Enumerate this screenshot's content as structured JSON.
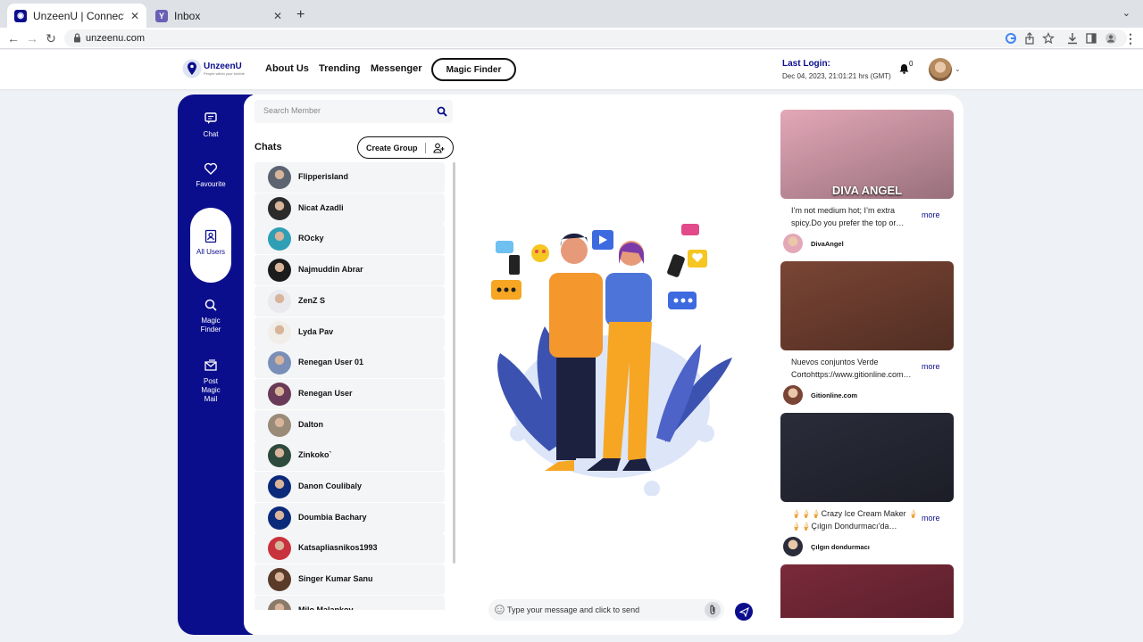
{
  "browser": {
    "tabs": [
      {
        "title": "UnzeenU | Connect your bubbl",
        "active": true
      },
      {
        "title": "Inbox",
        "active": false
      }
    ],
    "new_tab": "+",
    "url": "unzeenu.com"
  },
  "site": {
    "brand": "UnzeenU",
    "tagline": "People within your bubble",
    "nav": [
      "About Us",
      "Trending",
      "Messenger"
    ],
    "magic_finder": "Magic Finder",
    "last_login_label": "Last Login:",
    "last_login_value": "Dec 04, 2023, 21:01:21 hrs (GMT)",
    "notif_count": "0"
  },
  "sidebar": {
    "items": [
      {
        "label": "Chat",
        "icon": "chat-icon"
      },
      {
        "label": "Favourite",
        "icon": "heart-icon"
      },
      {
        "label": "All Users",
        "icon": "users-icon",
        "active": true
      },
      {
        "label": "Magic Finder",
        "icon": "search-icon"
      },
      {
        "label": "Post Magic Mail",
        "icon": "mail-icon"
      }
    ]
  },
  "chats": {
    "search_placeholder": "Search Member",
    "title": "Chats",
    "create_group": "Create Group",
    "list": [
      {
        "name": "Flipperisland",
        "color": "#5b6470"
      },
      {
        "name": "Nicat Azadli",
        "color": "#2b2b2b"
      },
      {
        "name": "ROcky",
        "color": "#2f9fb5"
      },
      {
        "name": "Najmuddin Abrar",
        "color": "#1c1c1c"
      },
      {
        "name": "ZenZ S",
        "color": "#e9e9ee"
      },
      {
        "name": "Lyda Pav",
        "color": "#f1ede8"
      },
      {
        "name": "Renegan User 01",
        "color": "#7a8fb8"
      },
      {
        "name": "Renegan User",
        "color": "#6a3b58"
      },
      {
        "name": "Dalton",
        "color": "#9a8a78"
      },
      {
        "name": "Zinkoko`",
        "color": "#2e4a3c"
      },
      {
        "name": "Danon Coulibaly",
        "color": "#0b2a7a"
      },
      {
        "name": "Doumbia Bachary",
        "color": "#0b2a7a"
      },
      {
        "name": "Katsapliasnikos1993",
        "color": "#c8323c"
      },
      {
        "name": "Singer Kumar Sanu",
        "color": "#5a3a28"
      },
      {
        "name": "Milo Malankov",
        "color": "#8a7a6a"
      }
    ]
  },
  "composer": {
    "placeholder": "Type your message and click to send"
  },
  "feed": [
    {
      "caption": "I’m not medium hot; I’m extra spicy.Do you prefer the top or…",
      "more": "more",
      "user": "DivaAngel",
      "image_text": "DIVA ANGEL",
      "bg": "#e3a7b8"
    },
    {
      "caption": "Nuevos conjuntos Verde Cortohttps://www.gitionline.com…",
      "more": "more",
      "user": "Gitionline.com",
      "image_text": "",
      "bg": "#7a4535"
    },
    {
      "caption": "🍦🍦🍦Crazy Ice Cream Maker 🍦🍦🍦Çılgın Dondurmacı’da…",
      "more": "more",
      "user": "Çılgın dondurmacı",
      "image_text": "",
      "bg": "#2a2c3a"
    },
    {
      "caption": "",
      "more": "",
      "user": "",
      "image_text": "",
      "bg": "#7a2a3a"
    }
  ],
  "colors": {
    "brand": "#0b0e8c",
    "sidebar_bg": "#0b0e8c",
    "page_bg": "#eef1f5"
  }
}
